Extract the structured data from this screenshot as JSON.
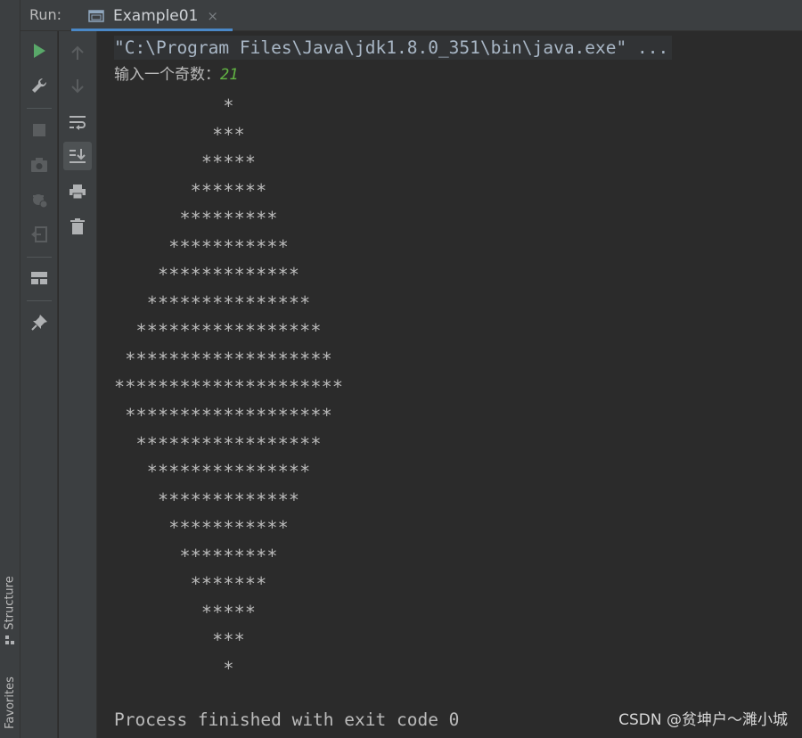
{
  "header": {
    "run_label": "Run:",
    "tab": {
      "label": "Example01",
      "close": "×"
    }
  },
  "stripe": {
    "structure_label": "Structure",
    "favorites_label": "Favorites"
  },
  "console": {
    "command": "\"C:\\Program Files\\Java\\jdk1.8.0_351\\bin\\java.exe\" ...",
    "prompt": "输入一个奇数：",
    "input_value": "21",
    "diamond_rows": [
      "          *",
      "         ***",
      "        *****",
      "       *******",
      "      *********",
      "     ***********",
      "    *************",
      "   ***************",
      "  *****************",
      " *******************",
      "*********************",
      " *******************",
      "  *****************",
      "   ***************",
      "    *************",
      "     ***********",
      "      *********",
      "       *******",
      "        *****",
      "         ***",
      "          *"
    ],
    "exit_message": "Process finished with exit code 0"
  },
  "watermark": "CSDN @贫坤户～濉小城",
  "colors": {
    "run_green": "#59a869",
    "input_green": "#62b543",
    "tab_accent": "#4a88c7",
    "icon_gray": "#afb1b3",
    "icon_disabled": "#5a5d5f"
  }
}
